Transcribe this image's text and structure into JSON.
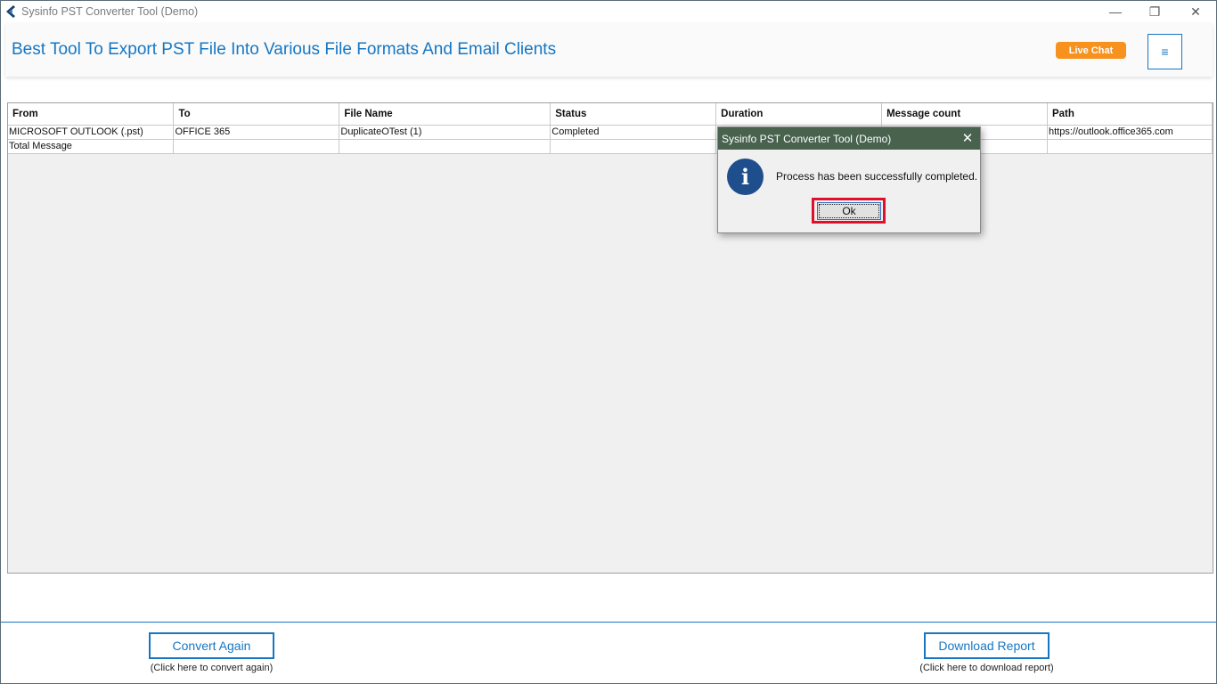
{
  "window": {
    "title": "Sysinfo PST Converter Tool (Demo)",
    "controls": {
      "minimize": "—",
      "maximize": "❐",
      "close": "✕"
    }
  },
  "banner": {
    "title": "Best Tool To Export PST File Into Various File Formats And Email Clients",
    "live_chat_label": "Live Chat",
    "menu_icon": "≡"
  },
  "table": {
    "columns": [
      "From",
      "To",
      "File Name",
      "Status",
      "Duration",
      "Message count",
      "Path"
    ],
    "rows": [
      [
        "MICROSOFT OUTLOOK (.pst)",
        "OFFICE 365",
        "DuplicateOTest (1)",
        "Completed",
        "",
        "",
        "https://outlook.office365.com"
      ],
      [
        "Total Message",
        "",
        "",
        "",
        "",
        "",
        ""
      ]
    ]
  },
  "footer": {
    "convert_again_label": "Convert Again",
    "convert_again_hint": "(Click here to convert again)",
    "download_report_label": "Download Report",
    "download_report_hint": "(Click here to download report)"
  },
  "dialog": {
    "title": "Sysinfo PST Converter Tool (Demo)",
    "close_glyph": "✕",
    "info_glyph": "i",
    "message": "Process has been successfully completed.",
    "ok_label": "Ok"
  },
  "colors": {
    "accent": "#1577c4",
    "live_chat": "#f7921e",
    "dialog_titlebar": "#48624e",
    "highlight": "#e0102a"
  }
}
